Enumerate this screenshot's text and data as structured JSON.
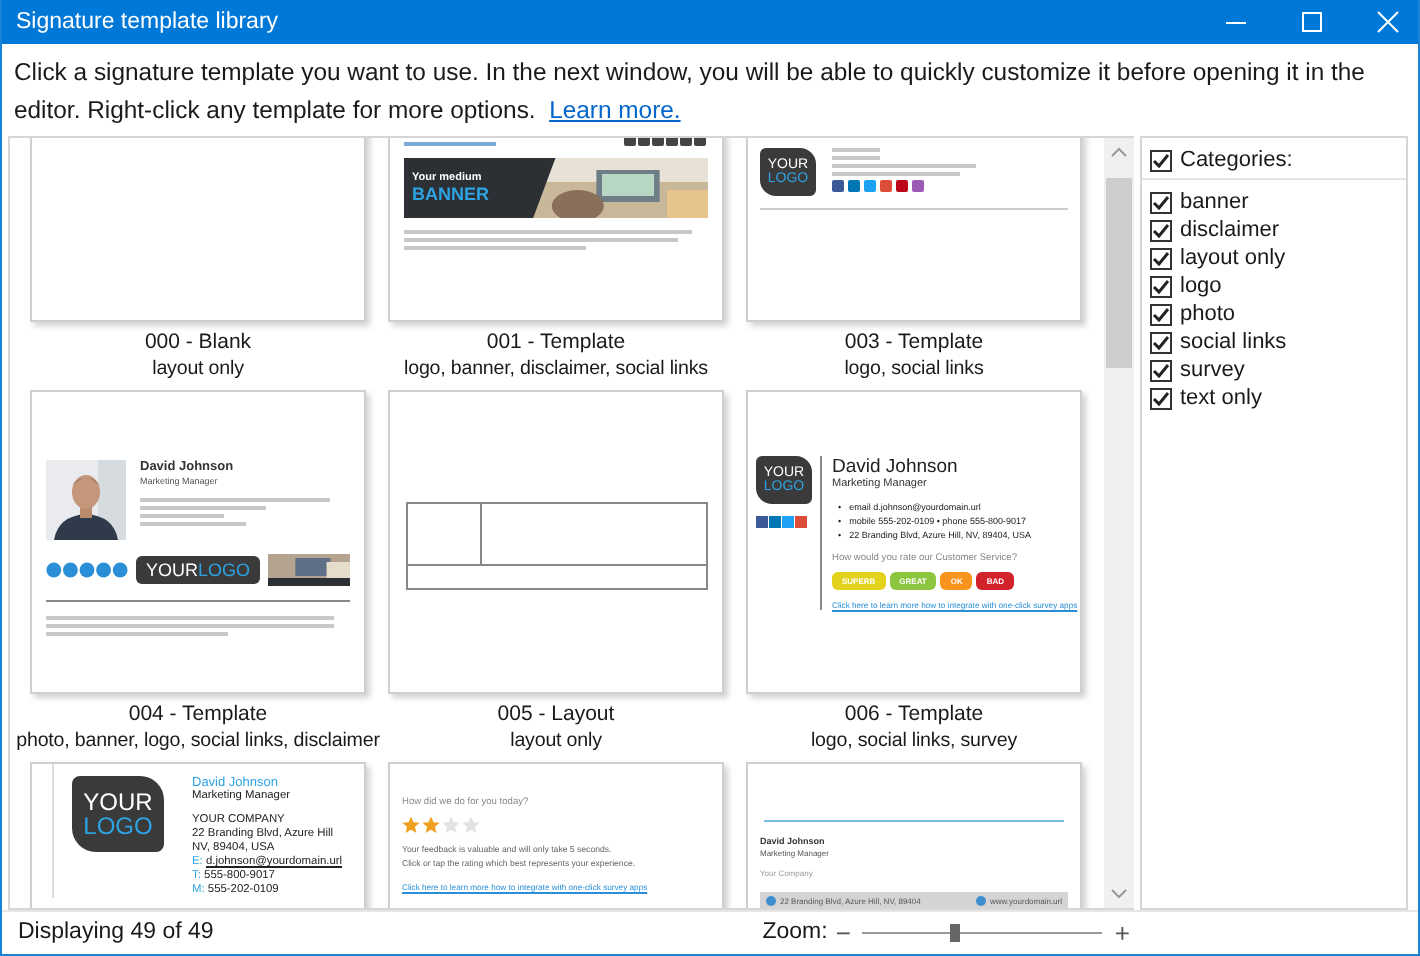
{
  "window": {
    "title": "Signature template library"
  },
  "intro": {
    "text": "Click a signature template you want to use. In the next window, you will be able to quickly customize it before opening it in the editor. Right-click any template for more options.",
    "link": "Learn more."
  },
  "templates": [
    {
      "kind": "blank",
      "name": "000 - Blank",
      "tags": "layout only"
    },
    {
      "kind": "banner",
      "name": "001 - Template",
      "tags": "logo, banner, disclaimer, social links",
      "banner_title": "Your medium",
      "banner_word": "BANNER"
    },
    {
      "kind": "logo",
      "name": "003 - Template",
      "tags": "logo, social links",
      "logo": [
        "YOUR",
        "LOGO"
      ]
    },
    {
      "name": "004 - Template",
      "tags": "photo, banner, logo, social links, disclaimer",
      "person": "David Johnson",
      "role": "Marketing Manager",
      "logo": [
        "YOUR",
        "LOGO"
      ]
    },
    {
      "kind": "layout",
      "name": "005 - Layout",
      "tags": "layout only"
    },
    {
      "kind": "survey",
      "name": "006 - Template",
      "tags": "logo, social links, survey",
      "logo": [
        "YOUR",
        "LOGO"
      ],
      "person": "David Johnson",
      "role": "Marketing Manager",
      "bullet": "•",
      "bullets": [
        "email d.johnson@yourdomain.url",
        "mobile 555-202-0109 • phone 555-800-9017",
        "22 Branding Blvd, Azure Hill, NV, 89404, USA"
      ],
      "question": "How would you rate our Customer Service?",
      "answers": [
        {
          "label": "SUPERB",
          "color": "#e3d21b"
        },
        {
          "label": "GREAT",
          "color": "#8cc63f"
        },
        {
          "label": "OK",
          "color": "#f7941d"
        },
        {
          "label": "BAD",
          "color": "#d2232a"
        }
      ],
      "link": "Click here to learn more how to integrate with one-click survey apps"
    },
    {
      "kind": "company",
      "logo": [
        "YOUR",
        "LOGO"
      ],
      "person": "David Johnson",
      "role": "Marketing Manager",
      "lines": [
        "YOUR COMPANY",
        "22 Branding Blvd, Azure Hill",
        "NV, 89404, USA"
      ],
      "contacts": [
        {
          "label": "E:",
          "value": "d.johnson@yourdomain.url"
        },
        {
          "label": "T:",
          "value": "555-800-9017"
        },
        {
          "label": "M:",
          "value": "555-202-0109"
        }
      ]
    },
    {
      "kind": "rating",
      "question": "How did we do for you today?",
      "stars": 2,
      "note": [
        "Your feedback is valuable and will only take 5 seconds.",
        "Click or tap the rating which best represents your experience."
      ],
      "link": "Click here to learn more how to integrate with one-click survey apps"
    },
    {
      "kind": "footer",
      "person": "David Johnson",
      "role": "Marketing Manager",
      "company": "Your Company",
      "address": "22 Branding Blvd, Azure Hill, NV, 89404",
      "site": "www.yourdomain.url"
    }
  ],
  "categories": {
    "label": "Categories:",
    "checked": true,
    "items": [
      {
        "label": "banner",
        "checked": true
      },
      {
        "label": "disclaimer",
        "checked": true
      },
      {
        "label": "layout only",
        "checked": true
      },
      {
        "label": "logo",
        "checked": true
      },
      {
        "label": "photo",
        "checked": true
      },
      {
        "label": "social links",
        "checked": true
      },
      {
        "label": "survey",
        "checked": true
      },
      {
        "label": "text only",
        "checked": true
      }
    ]
  },
  "status": {
    "text": "Displaying 49 of 49",
    "zoom_label": "Zoom:",
    "minus": "−",
    "plus": "+",
    "level": 0.39
  }
}
